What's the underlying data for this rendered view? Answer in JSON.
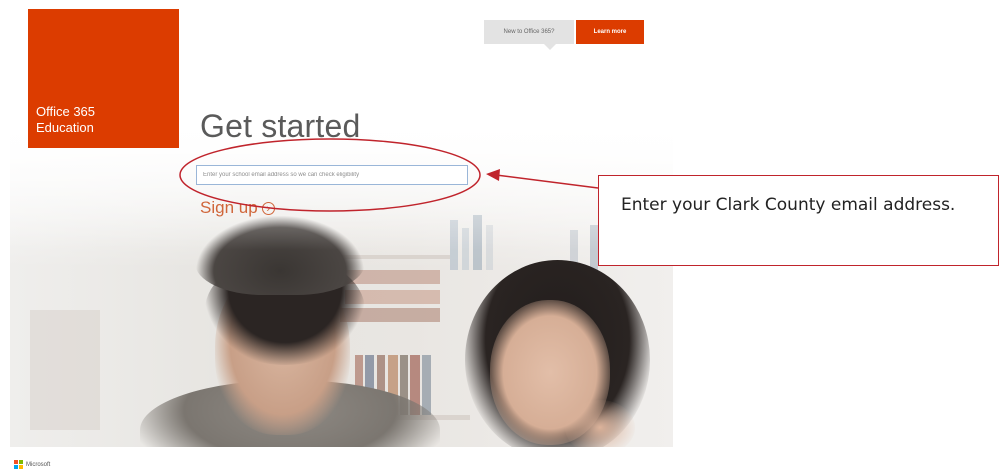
{
  "brand": {
    "line1": "Office 365",
    "line2": "Education",
    "color": "#dc3c00"
  },
  "header": {
    "new_to_label": "New to Office 365?",
    "learn_more_label": "Learn more"
  },
  "main": {
    "headline": "Get started",
    "email_placeholder": "Enter your school email address so we can check eligibility",
    "signup_label": "Sign up",
    "signup_icon": "arrow-circle-icon"
  },
  "annotation": {
    "callout_text": "Enter your Clark County email address.",
    "color": "#c0242c"
  },
  "footer": {
    "company": "Microsoft"
  }
}
